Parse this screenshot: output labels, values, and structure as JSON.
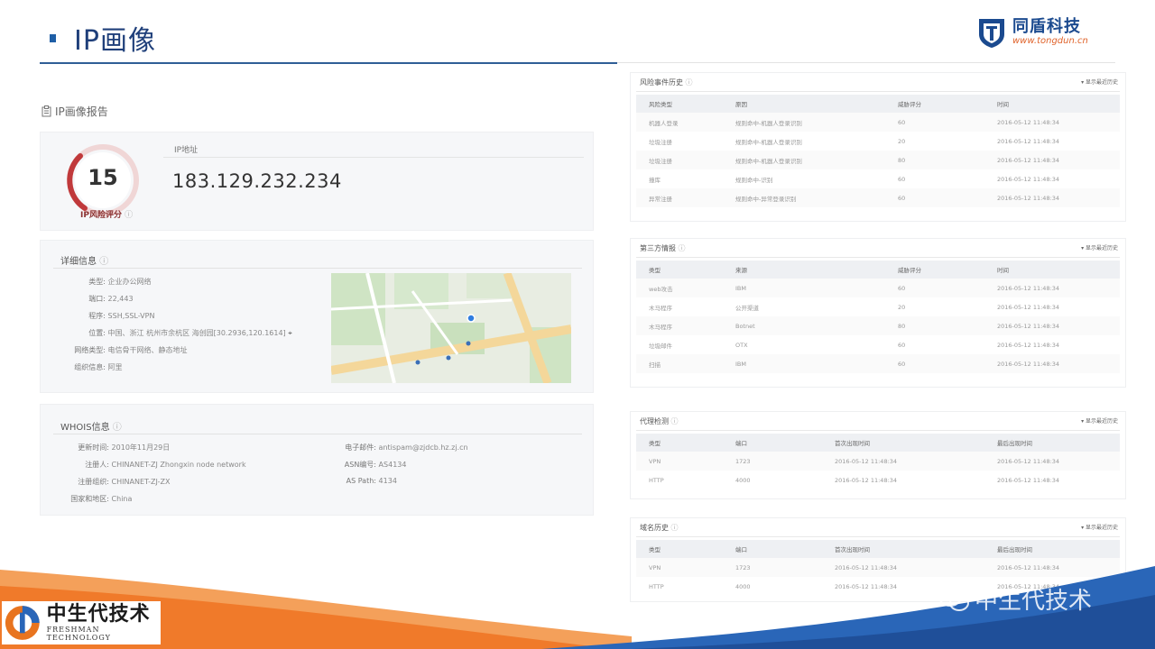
{
  "header": {
    "title": "IP画像",
    "company_name": "同盾科技",
    "company_url": "www.tongdun.cn"
  },
  "report": {
    "title": "IP画像报告",
    "score": "15",
    "score_label": "IP风险评分",
    "ip_label": "IP地址",
    "ip_value": "183.129.232.234"
  },
  "detail": {
    "title": "详细信息",
    "rows": [
      {
        "key": "类型:",
        "value": "企业办公网络"
      },
      {
        "key": "端口:",
        "value": "22,443"
      },
      {
        "key": "程序:",
        "value": "SSH,SSL-VPN"
      },
      {
        "key": "位置:",
        "value": "中国、浙江 杭州市余杭区 海创园[30.2936,120.1614]"
      },
      {
        "key": "网络类型:",
        "value": "电信骨干网络、静态地址"
      },
      {
        "key": "组织信息:",
        "value": "阿里"
      }
    ]
  },
  "whois": {
    "title": "WHOIS信息",
    "left": [
      {
        "key": "更新时间:",
        "value": "2010年11月29日"
      },
      {
        "key": "注册人:",
        "value": "CHINANET-ZJ Zhongxin node network"
      },
      {
        "key": "注册组织:",
        "value": "CHINANET-ZJ-ZX"
      },
      {
        "key": "国家和地区:",
        "value": "China"
      }
    ],
    "right": [
      {
        "key": "电子邮件:",
        "value": "antispam@zjdcb.hz.zj.cn"
      },
      {
        "key": "ASN编号:",
        "value": "AS4134"
      },
      {
        "key": "AS Path:",
        "value": "4134"
      }
    ]
  },
  "tables": [
    {
      "title": "风险事件历史",
      "more": "▾ 显示最近历史",
      "headers": [
        "风险类型",
        "原因",
        "威胁评分",
        "时间"
      ],
      "rows": [
        [
          "机器人登录",
          "规则命中-机器人登录识别",
          "60",
          "2016-05-12 11:48:34"
        ],
        [
          "垃圾注册",
          "规则命中-机器人登录识别",
          "20",
          "2016-05-12 11:48:34"
        ],
        [
          "垃圾注册",
          "规则命中-机器人登录识别",
          "80",
          "2016-05-12 11:48:34"
        ],
        [
          "撞库",
          "规则命中-识别",
          "60",
          "2016-05-12 11:48:34"
        ],
        [
          "异常注册",
          "规则命中-异常登录识别",
          "60",
          "2016-05-12 11:48:34"
        ]
      ]
    },
    {
      "title": "第三方情报",
      "more": "▾ 显示最近历史",
      "headers": [
        "类型",
        "来源",
        "威胁评分",
        "时间"
      ],
      "rows": [
        [
          "web攻击",
          "IBM",
          "60",
          "2016-05-12 11:48:34"
        ],
        [
          "木马程序",
          "公开渠道",
          "20",
          "2016-05-12 11:48:34"
        ],
        [
          "木马程序",
          "Botnet",
          "80",
          "2016-05-12 11:48:34"
        ],
        [
          "垃圾邮件",
          "OTX",
          "60",
          "2016-05-12 11:48:34"
        ],
        [
          "扫描",
          "IBM",
          "60",
          "2016-05-12 11:48:34"
        ]
      ]
    },
    {
      "title": "代理检测",
      "more": "▾ 显示最近历史",
      "headers": [
        "类型",
        "端口",
        "首次出现时间",
        "最后出现时间"
      ],
      "rows": [
        [
          "VPN",
          "1723",
          "2016-05-12 11:48:34",
          "2016-05-12 11:48:34"
        ],
        [
          "HTTP",
          "4000",
          "2016-05-12 11:48:34",
          "2016-05-12 11:48:34"
        ]
      ]
    },
    {
      "title": "域名历史",
      "more": "▾ 显示最近历史",
      "headers": [
        "类型",
        "端口",
        "首次出现时间",
        "最后出现时间"
      ],
      "rows": [
        [
          "VPN",
          "1723",
          "2016-05-12 11:48:34",
          "2016-05-12 11:48:34"
        ],
        [
          "HTTP",
          "4000",
          "2016-05-12 11:48:34",
          "2016-05-12 11:48:34"
        ]
      ]
    }
  ],
  "footer": {
    "brand_cn": "中生代技术",
    "brand_en": "FRESHMAN TECHNOLOGY",
    "watermark": "中生代技术"
  },
  "colors": {
    "title_blue": "#1f3f7a",
    "accent_red": "#c0393b",
    "footer_orange": "#f07a2a",
    "footer_blue": "#1f5aa8"
  }
}
